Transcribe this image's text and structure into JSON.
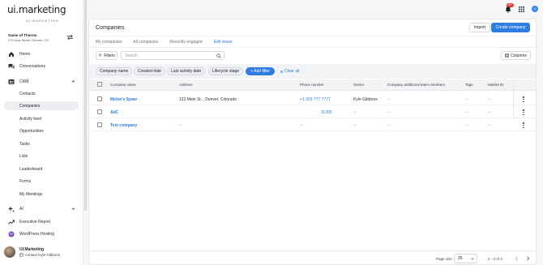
{
  "sidebar": {
    "logo": "ui.marketing",
    "logo_sub": "UI.MARKETING",
    "account_name": "Game of Therms",
    "account_address": "470 Inca Street, Denver, CO",
    "items": {
      "home": "Home",
      "conversations": "Conversations",
      "crm": "CRM",
      "ai": "AI",
      "executive_report": "Executive Report",
      "wordpress_hosting": "WordPress Hosting"
    },
    "crm_sub": [
      "Contacts",
      "Companies",
      "Activity feed",
      "Opportunities",
      "Tasks",
      "Lists",
      "Leaderboard",
      "Forms",
      "My Meetings"
    ],
    "active_sub": "Companies",
    "user_name": "UI.Marketing",
    "user_contact": "Contact Kyle Gibbons"
  },
  "topbar": {
    "notification_count": "99+",
    "avatar_initial": "U"
  },
  "page": {
    "title": "Companies",
    "import_label": "Import",
    "create_label": "Create company",
    "tabs": [
      "My companies",
      "All companies",
      "Recently engaged"
    ],
    "edit_views": "Edit views",
    "filters_label": "Filters",
    "search_placeholder": "Search",
    "columns_label": "Columns",
    "chips": [
      "Company name",
      "Created date",
      "Last activity date",
      "Lifecycle stage"
    ],
    "add_filter": "Add filter",
    "clear_all": "Clear all"
  },
  "table": {
    "headers": [
      "Company name",
      "Address",
      "Phone number",
      "Owner",
      "Company additional team members",
      "Tags",
      "Market ID"
    ],
    "rows": [
      {
        "name": "Melon's Spaw",
        "address": "123 Main St. , Denver, Colorado",
        "phone": "+1 303 777 7777",
        "owner": "Kyle Gibbons",
        "team": "--",
        "tags": "--",
        "market": "--"
      },
      {
        "name": "AdC",
        "address": "",
        "phone": "11355",
        "owner": "--",
        "team": "--",
        "tags": "--",
        "market": "--"
      },
      {
        "name": "Test company",
        "address": "--",
        "phone": "--",
        "owner": "--",
        "team": "--",
        "tags": "--",
        "market": "--"
      }
    ]
  },
  "footer": {
    "page_size_label": "Page size",
    "page_size": "25",
    "range": "1 - 3 of 3"
  },
  "colors": {
    "accent": "#2f7de1",
    "badge": "#e0352b"
  }
}
